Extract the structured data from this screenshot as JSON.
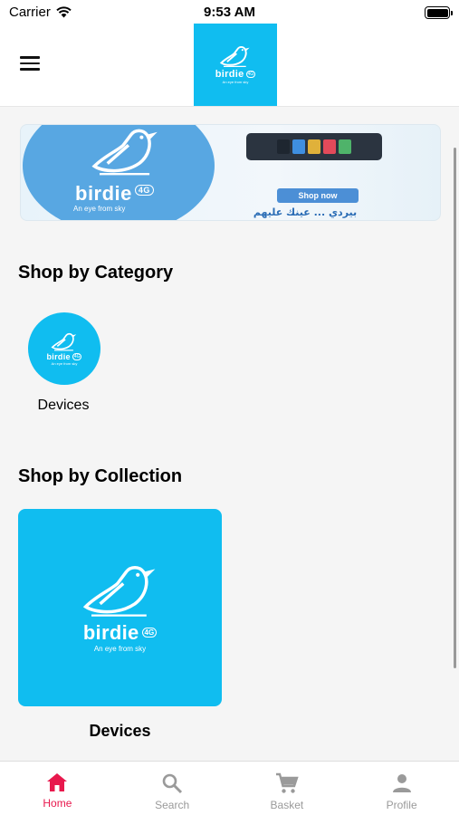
{
  "status_bar": {
    "carrier": "Carrier",
    "time": "9:53 AM"
  },
  "brand": {
    "name": "birdie",
    "badge": "4G",
    "tagline": "An eye from sky",
    "color": "#10bdf0"
  },
  "banner": {
    "shop_now": "Shop now",
    "arabic_text": "بيردي ... عينك عليهم"
  },
  "sections": {
    "category": {
      "title": "Shop by Category",
      "items": [
        {
          "label": "Devices"
        }
      ]
    },
    "collection": {
      "title": "Shop by Collection",
      "items": [
        {
          "label": "Devices"
        }
      ]
    }
  },
  "tabs": [
    {
      "label": "Home",
      "icon": "home-icon",
      "active": true
    },
    {
      "label": "Search",
      "icon": "search-icon",
      "active": false
    },
    {
      "label": "Basket",
      "icon": "cart-icon",
      "active": false
    },
    {
      "label": "Profile",
      "icon": "person-icon",
      "active": false
    }
  ],
  "colors": {
    "accent": "#e8184d",
    "inactive": "#9a9a9a",
    "banner_blue": "#58a7e2"
  }
}
